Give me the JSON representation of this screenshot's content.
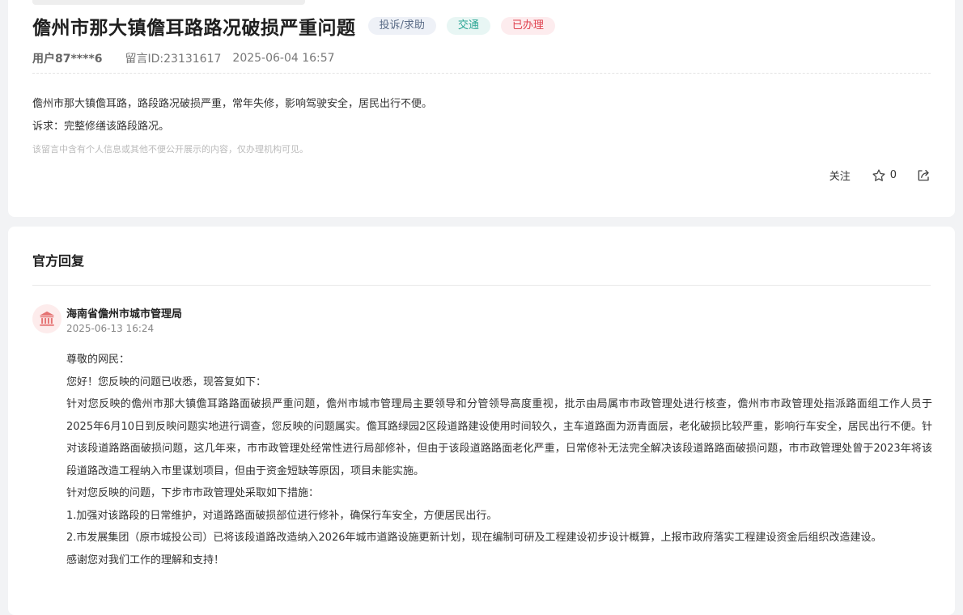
{
  "message": {
    "title": "儋州市那大镇儋耳路路况破损严重问题",
    "tags": {
      "type": "投诉/求助",
      "topic": "交通",
      "status": "已办理"
    },
    "user": "用户87****6",
    "message_id": "留言ID:23131617",
    "datetime": "2025-06-04 16:57",
    "content": "儋州市那大镇儋耳路，路段路况破损严重，常年失修，影响驾驶安全，居民出行不便。",
    "demand": "诉求：完整修缮该路段路况。",
    "privacy_note": "该留言中含有个人信息或其他不便公开展示的内容，仅办理机构可见。",
    "actions": {
      "follow_label": "关注",
      "favorite_count": "0"
    }
  },
  "reply": {
    "section_title": "官方回复",
    "org_name": "海南省儋州市城市管理局",
    "datetime": "2025-06-13 16:24",
    "paragraphs": [
      "尊敬的网民：",
      "您好！您反映的问题已收悉，现答复如下：",
      "针对您反映的儋州市那大镇儋耳路路面破损严重问题，儋州市城市管理局主要领导和分管领导高度重视，批示由局属市市政管理处进行核查，儋州市市政管理处指派路面组工作人员于2025年6月10日到反映问题实地进行调查，您反映的问题属实。儋耳路绿园2区段道路建设使用时间较久，主车道路面为沥青面层，老化破损比较严重，影响行车安全，居民出行不便。针对该段道路路面破损问题，这几年来，市市政管理处经常性进行局部修补，但由于该段道路路面老化严重，日常修补无法完全解决该段道路路面破损问题，市市政管理处曾于2023年将该段道路改造工程纳入市里谋划项目，但由于资金短缺等原因，项目未能实施。",
      "针对您反映的问题，下步市市政管理处采取如下措施：",
      "1.加强对该路段的日常维护，对道路路面破损部位进行修补，确保行车安全，方便居民出行。",
      "2.市发展集团（原市城投公司）已将该段道路改造纳入2026年城市道路设施更新计划，现在编制可研及工程建设初步设计概算，上报市政府落实工程建设资金后组织改造建设。",
      "感谢您对我们工作的理解和支持！"
    ]
  },
  "colors": {
    "status_red": "#e0424f",
    "topic_green": "#2aa593",
    "type_gray": "#5a6b86",
    "org_icon": "#e57373"
  },
  "icons": [
    "star-icon",
    "share-icon",
    "government-building-icon"
  ]
}
